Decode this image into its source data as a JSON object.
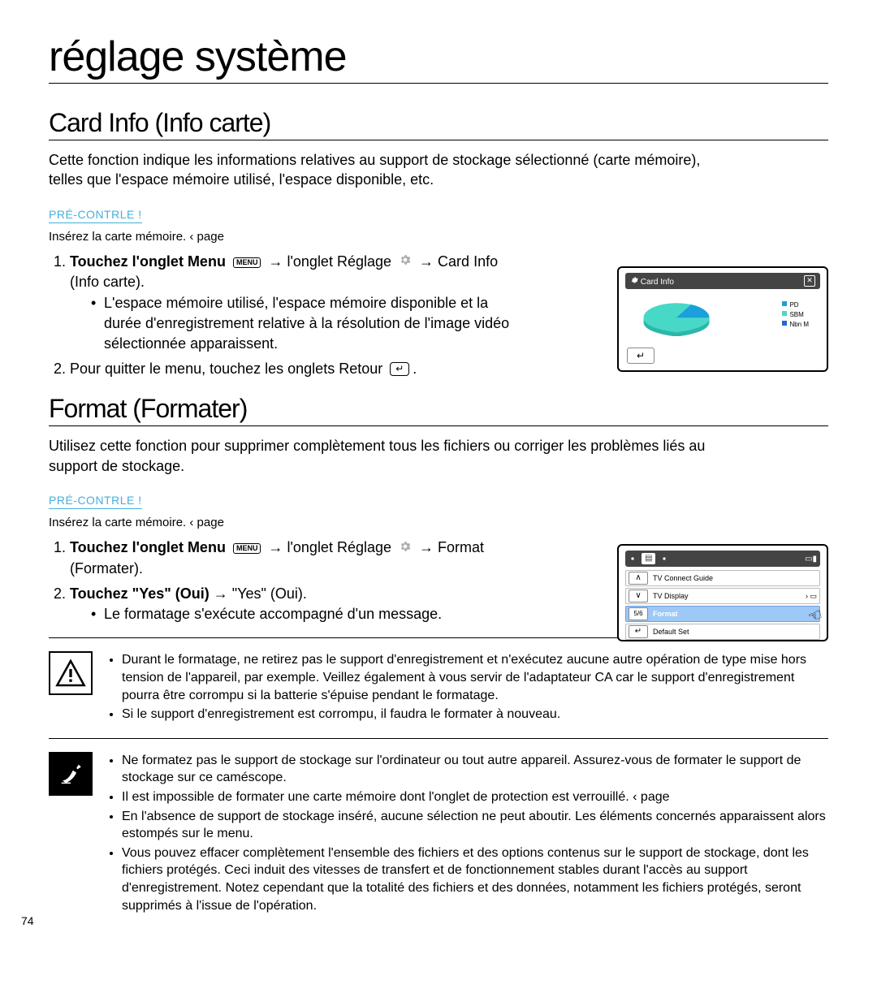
{
  "page_title": "réglage système",
  "page_number": "74",
  "section1": {
    "title": "Card Info (Info carte)",
    "intro": "Cette fonction indique les informations relatives au support de stockage sélectionné (carte mémoire), telles que l'espace mémoire utilisé, l'espace disponible, etc.",
    "precontrol": "PRÉ-CONTRLE !",
    "note": "Insérez la carte mémoire.   ‹ page",
    "step1_a": "Touchez l'onglet Menu",
    "menu_badge": "MENU",
    "step1_b": "→ l'onglet Réglage",
    "step1_c": "Card Info (Info carte).",
    "bullet": "L'espace mémoire utilisé, l'espace mémoire disponible et la durée d'enregistrement relative à la résolution de l'image vidéo sélectionnée apparaissent.",
    "step2": "Pour quitter le menu, touchez les onglets Retour",
    "figure": {
      "title": "Card Info",
      "legend_a": "PD",
      "legend_b": "SBM",
      "legend_c": "Nbn M"
    }
  },
  "section2": {
    "title": "Format (Formater)",
    "intro": "Utilisez cette fonction pour supprimer complètement tous les fichiers ou corriger les problèmes liés au support de stockage.",
    "precontrol": "PRÉ-CONTRLE !",
    "note": "Insérez la carte mémoire.   ‹ page",
    "step1_a": "Touchez l'onglet Menu",
    "step1_b": "→ l'onglet Réglage",
    "step1_c": "Format (Formater).",
    "step2_a": "Touchez \"Yes\" (Oui)",
    "step2_b": "→ \"Yes\" (Oui).",
    "bullet": "Le formatage s'exécute accompagné d'un message.",
    "figure": {
      "row1": "TV Connect Guide",
      "row2": "TV Display",
      "row3_index": "5/6",
      "row3": "Format",
      "row4": "Default Set"
    }
  },
  "warning": {
    "line1": "Durant le formatage, ne retirez pas le support d'enregistrement et n'exécutez aucune autre opération de type mise hors tension de l'appareil, par exemple. Veillez également à vous servir de l'adaptateur CA car le support d'enregistrement pourra être corrompu si la batterie s'épuise pendant le formatage.",
    "line2": "Si le support d'enregistrement est corrompu, il faudra le formater à nouveau."
  },
  "notes": {
    "n1": "Ne formatez pas le support de stockage sur l'ordinateur ou tout autre appareil. Assurez-vous de formater le support de stockage sur ce caméscope.",
    "n2": "Il est impossible de formater une carte mémoire dont l'onglet de protection est verrouillé.   ‹ page",
    "n3": "En l'absence de support de stockage inséré, aucune sélection ne peut aboutir. Les éléments concernés apparaissent alors estompés sur le menu.",
    "n4": "Vous pouvez effacer complètement l'ensemble des fichiers et des options contenus sur le support de stockage, dont les fichiers protégés. Ceci induit des vitesses de transfert et de fonctionnement stables durant l'accès au support d'enregistrement. Notez cependant que la totalité des fichiers et des données, notamment les fichiers protégés, seront supprimés à l'issue de l'opération."
  }
}
